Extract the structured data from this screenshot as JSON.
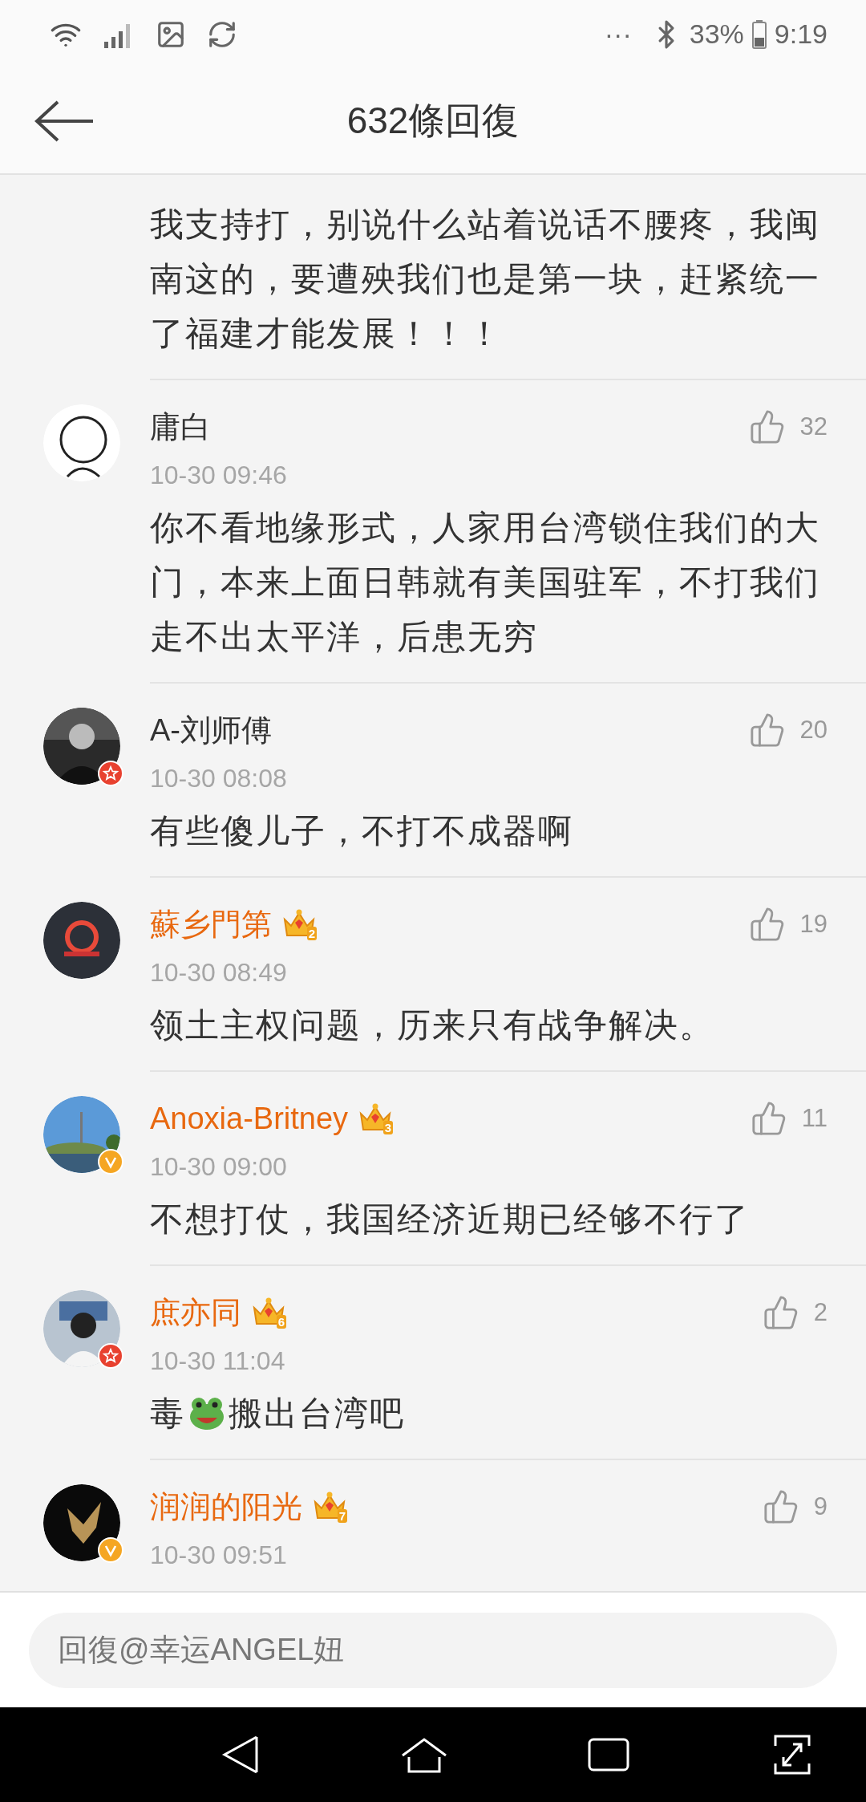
{
  "status_bar": {
    "more": "···",
    "battery": "33%",
    "time": "9:19"
  },
  "header": {
    "title": "632條回復"
  },
  "comments": [
    {
      "body": "我支持打，别说什么站着说话不腰疼，我闽南这的，要遭殃我们也是第一块，赶紧统一了福建才能发展！！！"
    },
    {
      "name": "庸白",
      "vip": false,
      "star_badge": false,
      "verified": false,
      "likes": "32",
      "time": "10-30 09:46",
      "body": "你不看地缘形式，人家用台湾锁住我们的大门，本来上面日韩就有美国驻军，不打我们走不出太平洋，后患无穷"
    },
    {
      "name": "A-刘师傅",
      "vip": false,
      "star_badge": true,
      "verified": false,
      "likes": "20",
      "time": "10-30 08:08",
      "body": "有些傻儿子，不打不成器啊"
    },
    {
      "name": "蘇乡門第",
      "vip": true,
      "crown_level": "2",
      "star_badge": false,
      "verified": false,
      "likes": "19",
      "time": "10-30 08:49",
      "body": "领土主权问题，历来只有战争解决。"
    },
    {
      "name": "Anoxia-Britney",
      "vip": true,
      "crown_level": "3",
      "star_badge": false,
      "verified": true,
      "likes": "11",
      "time": "10-30 09:00",
      "body": "不想打仗，我国经济近期已经够不行了"
    },
    {
      "name": "庶亦同",
      "vip": true,
      "crown_level": "6",
      "star_badge": true,
      "verified": false,
      "likes": "2",
      "time": "10-30 11:04",
      "body_parts": [
        {
          "kind": "text",
          "text": "毒"
        },
        {
          "kind": "frog"
        },
        {
          "kind": "text",
          "text": "搬出台湾吧"
        }
      ]
    },
    {
      "name": "润润的阳光",
      "vip": true,
      "crown_level": "7",
      "star_badge": false,
      "verified": true,
      "likes": "9",
      "time": "10-30 09:51"
    }
  ],
  "reply": {
    "placeholder": "回復@幸运ANGEL妞"
  }
}
